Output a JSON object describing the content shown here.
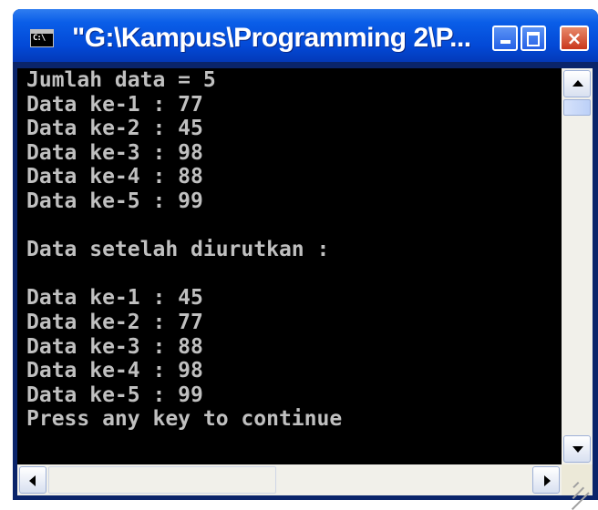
{
  "window": {
    "title": "\"G:\\Kampus\\Programming 2\\P...",
    "icon_label": "C:\\",
    "buttons": {
      "minimize": "minimize",
      "maximize": "maximize",
      "close": "×"
    }
  },
  "console": {
    "lines": [
      "Jumlah data = 5",
      "Data ke-1 : 77",
      "Data ke-2 : 45",
      "Data ke-3 : 98",
      "Data ke-4 : 88",
      "Data ke-5 : 99",
      "",
      "Data setelah diurutkan :",
      "",
      "Data ke-1 : 45",
      "Data ke-2 : 77",
      "Data ke-3 : 88",
      "Data ke-4 : 98",
      "Data ke-5 : 99",
      "Press any key to continue"
    ]
  },
  "icons": {
    "app": "console-icon",
    "scroll_up": "arrow-up-icon",
    "scroll_down": "arrow-down-icon",
    "scroll_left": "arrow-left-icon",
    "scroll_right": "arrow-right-icon",
    "resize": "resize-grip-icon"
  },
  "colors": {
    "titlebar": "#0a5ee8",
    "console_bg": "#000000",
    "console_text": "#c0c0c0",
    "close_button": "#c9371d"
  }
}
